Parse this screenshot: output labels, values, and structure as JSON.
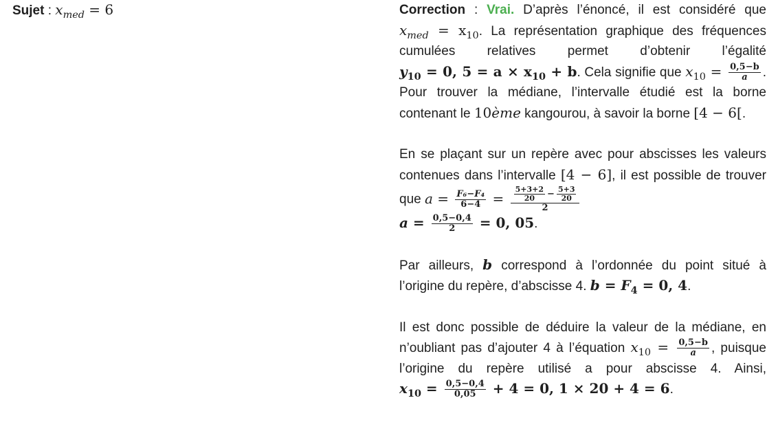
{
  "subject": {
    "label": "Sujet",
    "separator": " : ",
    "math_var": "x",
    "math_sub": "med",
    "math_eq": " = 6"
  },
  "correction": {
    "label": "Correction",
    "separator": " : ",
    "verdict": "Vrai.",
    "verdict_color": "#4caf50",
    "p1": {
      "t1": " D’après l’énoncé, il est considéré que ",
      "t2": ". La représentation graphique des fréquences cumulées relatives permet d’obtenir l’égalité ",
      "t3": ". Cela signifie que ",
      "t4": ". Pour trouver la médiane, l’intervalle étudié est la borne contenant le ",
      "t5": " kangourou, à savoir la borne ",
      "t6": ".",
      "eq_xmed": "= x",
      "sub10": "10",
      "eq_y10": "= 0, 5 = a × x",
      "eq_y10_tail": " + b",
      "frac_num": "0,5−b",
      "frac_den": "a",
      "tenth": "10",
      "tenth_suffix": "ème",
      "interval": "[4 − 6["
    },
    "p2": {
      "t1": "En se plaçant sur un repère avec pour abscisses les valeurs contenues dans l’intervalle ",
      "interval": "[4 − 6]",
      "t2": ", il est possible de trouver que ",
      "a_var": "a",
      "eq": " = ",
      "f1_num": "F₆−F₄",
      "f1_den": "6−4",
      "f2_num_a_num": "5+3+2",
      "f2_num_a_den": "20",
      "f2_num_b_num": "5+3",
      "f2_num_b_den": "20",
      "f2_den": "2",
      "line2_frac_num": "0,5−0,4",
      "line2_frac_den": "2",
      "line2_result": " = 0, 05",
      "line2_end": "."
    },
    "p3": {
      "t1": "Par ailleurs, ",
      "b_var": "b",
      "t2": " correspond à l’ordonnée du point situé à l’origine du repère, d’abscisse 4. ",
      "eq": "b = F",
      "eq_sub": "4",
      "eq_tail": " = 0, 4",
      "t3": "."
    },
    "p4": {
      "t1": "Il est donc possible de déduire la valeur de la médiane, en n’oubliant pas d’ajouter 4 à l’équation ",
      "x_var": "x",
      "sub10": "10",
      "eq": " = ",
      "frac_num": "0,5−b",
      "frac_den": "a",
      "t2": ", puisque l’origine du repère utilisé a pour abscisse 4. Ainsi, ",
      "final_frac_num": "0,5−0,4",
      "final_frac_den": "0,05",
      "final_tail": " + 4 = 0, 1 × 20 + 4 = 6",
      "end": "."
    }
  }
}
